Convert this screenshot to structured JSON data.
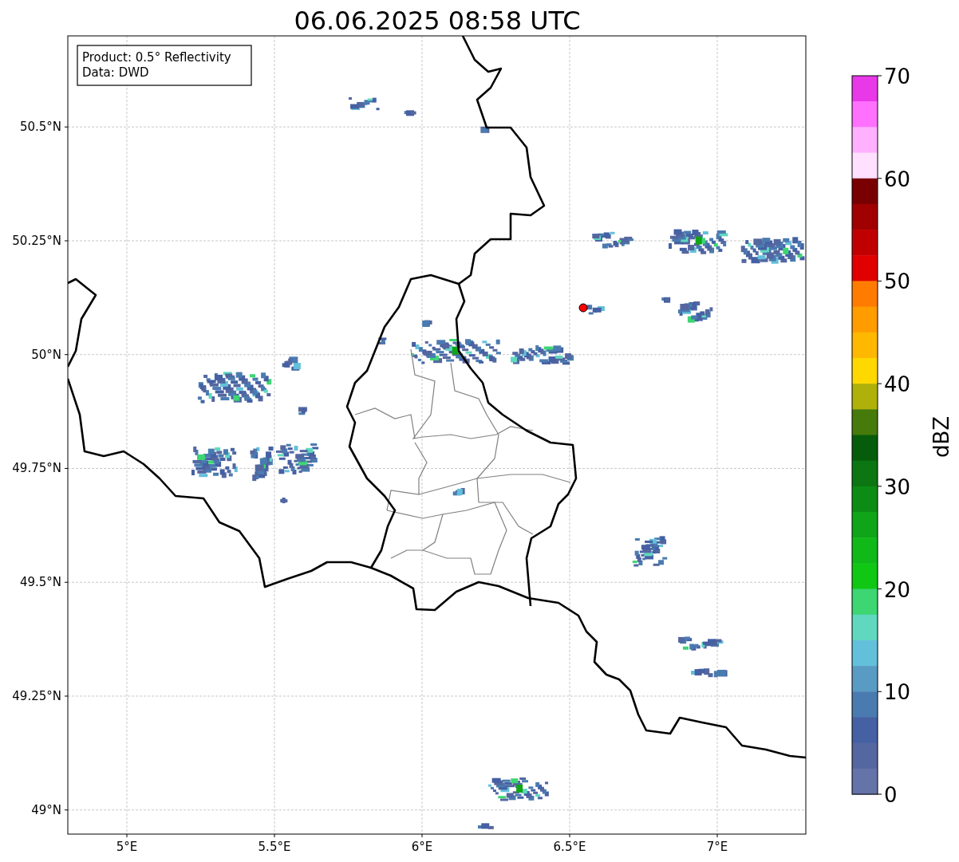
{
  "title": "06.06.2025 08:58 UTC",
  "info_box": [
    "Product: 0.5° Reflectivity",
    "Data: DWD"
  ],
  "map": {
    "yticks": [
      "50.5°N",
      "50.25°N",
      "50°N",
      "49.75°N",
      "49.5°N",
      "49.25°N",
      "49°N"
    ],
    "xticks": [
      "5°E",
      "5.5°E",
      "6°E",
      "6.5°E",
      "7°E"
    ]
  },
  "colorbar": {
    "label": "dBZ",
    "ticks": [
      "70",
      "60",
      "50",
      "40",
      "30",
      "20",
      "10",
      "0"
    ],
    "segments": [
      {
        "color": "#e838e8"
      },
      {
        "color": "#ff70ff"
      },
      {
        "color": "#ffb0ff"
      },
      {
        "color": "#ffe0ff"
      },
      {
        "color": "#780000"
      },
      {
        "color": "#a00000"
      },
      {
        "color": "#c00000"
      },
      {
        "color": "#e00000"
      },
      {
        "color": "#ff7c00"
      },
      {
        "color": "#ff9c00"
      },
      {
        "color": "#ffb800"
      },
      {
        "color": "#ffd800"
      },
      {
        "color": "#b0b00a"
      },
      {
        "color": "#467a0a"
      },
      {
        "color": "#065c0a"
      },
      {
        "color": "#0b7612"
      },
      {
        "color": "#0c8c14"
      },
      {
        "color": "#10a418"
      },
      {
        "color": "#10b818"
      },
      {
        "color": "#10c814"
      },
      {
        "color": "#3dd673"
      },
      {
        "color": "#60d8c0"
      },
      {
        "color": "#63c0da"
      },
      {
        "color": "#5a9bc4"
      },
      {
        "color": "#4a7bb0"
      },
      {
        "color": "#4560a3"
      },
      {
        "color": "#5467a0"
      },
      {
        "color": "#6473a8"
      }
    ]
  }
}
